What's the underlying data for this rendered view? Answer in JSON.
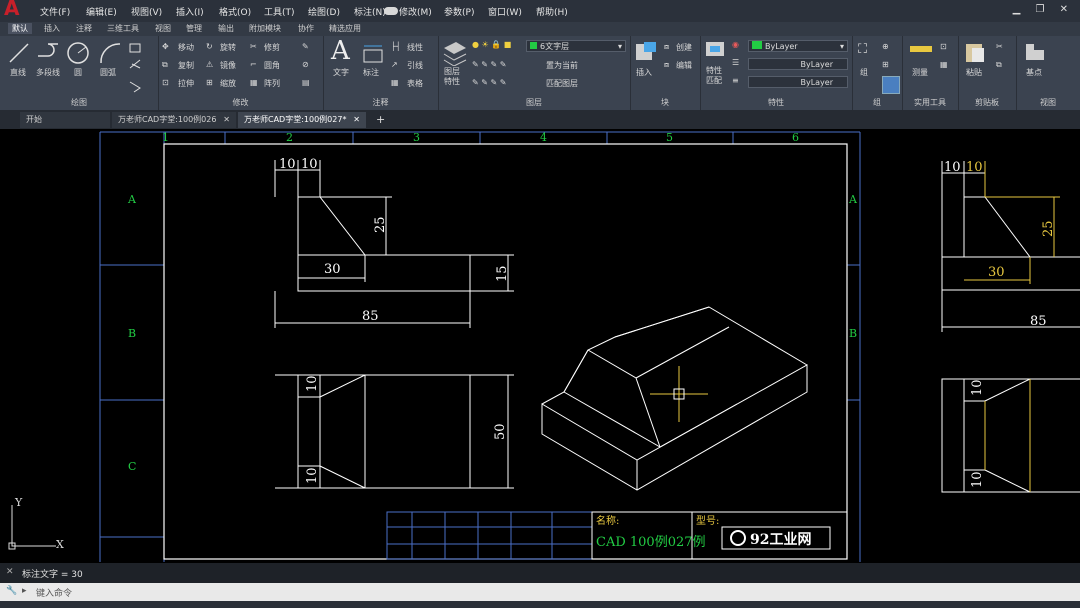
{
  "menubar": {
    "items": [
      "文件(F)",
      "编辑(E)",
      "视图(V)",
      "插入(I)",
      "格式(O)",
      "工具(T)",
      "绘图(D)",
      "标注(N)",
      "修改(M)",
      "参数(P)",
      "窗口(W)",
      "帮助(H)"
    ]
  },
  "ribbon_tabs": [
    "默认",
    "插入",
    "注释",
    "三维工具",
    "视图",
    "管理",
    "输出",
    "附加模块",
    "协作",
    "精选应用"
  ],
  "ribbon": {
    "draw": {
      "title": "绘图",
      "line": "直线",
      "polyline": "多段线",
      "circle": "圆",
      "arc": "圆弧"
    },
    "modify": {
      "title": "修改",
      "move": "移动",
      "rotate": "旋转",
      "trim": "修剪",
      "copy": "复制",
      "mirror": "镜像",
      "fillet": "圆角",
      "stretch": "拉伸",
      "scale": "缩放",
      "array": "阵列"
    },
    "annotation": {
      "title": "注释",
      "text": "文字",
      "dimension": "标注",
      "linear": "线性",
      "leader": "引线",
      "table": "表格"
    },
    "layers": {
      "title": "图层",
      "properties": "图层\n特性",
      "current_layer": "6文字层",
      "make_current": "置为当前",
      "match": "匹配图层"
    },
    "block": {
      "title": "块",
      "insert": "插入",
      "create": "创建",
      "edit": "编辑"
    },
    "properties": {
      "title": "特性",
      "match": "特性\n匹配",
      "color": "ByLayer",
      "linetype": "ByLayer",
      "lineweight": "ByLayer"
    },
    "groups": {
      "title": "组",
      "group": "组"
    },
    "utilities": {
      "title": "实用工具",
      "measure": "测量"
    },
    "clipboard": {
      "title": "剪贴板",
      "paste": "粘贴"
    },
    "view": {
      "title": "视图",
      "base": "基点"
    }
  },
  "doc_tabs": [
    {
      "label": "开始"
    },
    {
      "label": "万老师CAD字堂:100例026"
    },
    {
      "label": "万老师CAD字堂:100例027*"
    }
  ],
  "drawing": {
    "col_numbers": [
      "1",
      "2",
      "3",
      "4",
      "5",
      "6"
    ],
    "row_letters": [
      "A",
      "B",
      "C"
    ],
    "dims": {
      "d10a": "10",
      "d10b": "10",
      "d25": "25",
      "d30": "30",
      "d15": "15",
      "d85": "85",
      "d10c": "10",
      "d10d": "10",
      "d50": "50"
    },
    "right_dims": {
      "d10a": "10",
      "d10b": "10",
      "d25": "25",
      "d30": "30",
      "d85": "85",
      "d10c": "10",
      "d10d": "10"
    },
    "title_block": {
      "name_label": "名称:",
      "name_value": "CAD 100例027例",
      "model_label": "型号:",
      "logo_text": "92工业网"
    }
  },
  "colors": {
    "line": "#ffffff",
    "dim": "#ffffff",
    "frame_green": "#22cc44",
    "blue": "#4a6fc8",
    "yellow": "#e8c840"
  },
  "command": {
    "history": "标注文字 = 30",
    "placeholder": "键入命令"
  }
}
